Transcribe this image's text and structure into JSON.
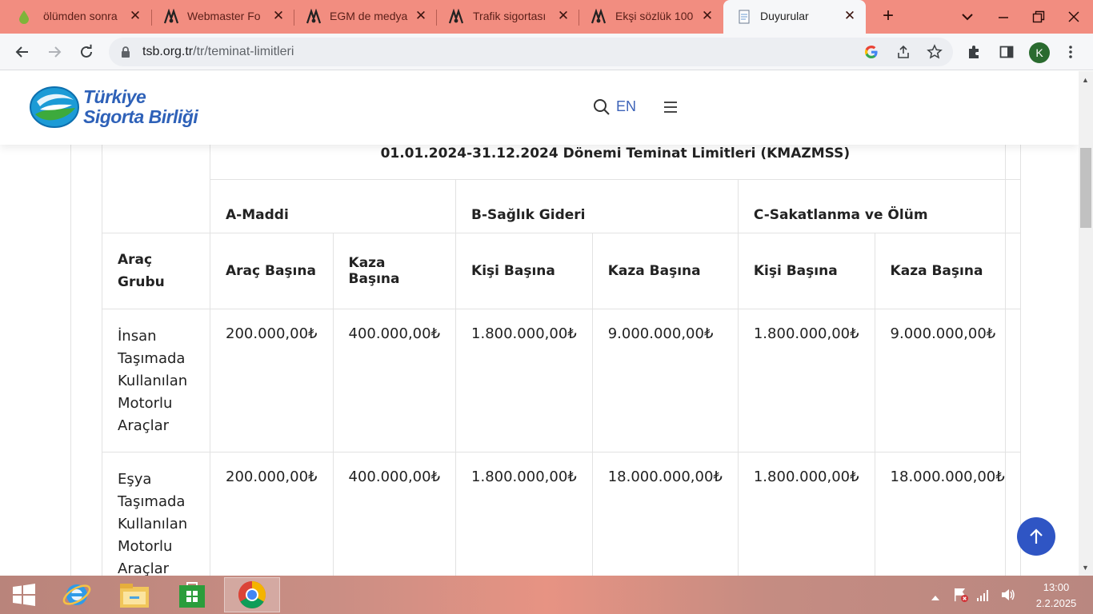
{
  "browser": {
    "tabs": [
      {
        "title": "ölümden sonra",
        "favicon": "green-drop-icon",
        "active": false
      },
      {
        "title": "Webmaster Fo",
        "favicon": "site-logo-icon",
        "active": false
      },
      {
        "title": "EGM de medya",
        "favicon": "site-logo-icon",
        "active": false
      },
      {
        "title": "Trafik sigortası",
        "favicon": "site-logo-icon",
        "active": false
      },
      {
        "title": "Ekşi sözlük 100",
        "favicon": "site-logo-icon",
        "active": false
      },
      {
        "title": "Duyurular",
        "favicon": "document-icon",
        "active": true
      }
    ],
    "url_host": "tsb.org.tr",
    "url_path": "/tr/teminat-limitleri",
    "profile_initial": "K",
    "colors": {
      "tabstrip": "#f28d80",
      "toolbar": "#f6f7f9",
      "avatar": "#2a6b2f"
    }
  },
  "site": {
    "logo_line1": "Türkiye",
    "logo_line2": "Sigorta Birliği",
    "lang": "EN",
    "accent": "#2f55c4"
  },
  "table": {
    "caption": "01.01.2024-31.12.2024 Dönemi Teminat Limitleri (KMAZMSS)",
    "row_header": "Araç Grubu",
    "groups": [
      "A-Maddi",
      "B-Sağlık Gideri",
      "C-Sakatlanma ve Ölüm"
    ],
    "subheaders": [
      "Araç Başına",
      "Kaza Başına",
      "Kişi Başına",
      "Kaza Başına",
      "Kişi Başına",
      "Kaza Başına"
    ],
    "rows": [
      {
        "name": "İnsan Taşımada Kullanılan Motorlu Araçlar",
        "values": [
          "200.000,00₺",
          "400.000,00₺",
          "1.800.000,00₺",
          "9.000.000,00₺",
          "1.800.000,00₺",
          "9.000.000,00₺"
        ]
      },
      {
        "name": "Eşya Taşımada Kullanılan Motorlu Araçlar",
        "values": [
          "200.000,00₺",
          "400.000,00₺",
          "1.800.000,00₺",
          "18.000.000,00₺",
          "1.800.000,00₺",
          "18.000.000,00₺"
        ]
      }
    ]
  },
  "taskbar": {
    "apps": [
      "start-icon",
      "internet-explorer-icon",
      "file-explorer-icon",
      "store-icon",
      "chrome-icon"
    ],
    "time": "13:00",
    "date": "2.2.2025"
  }
}
